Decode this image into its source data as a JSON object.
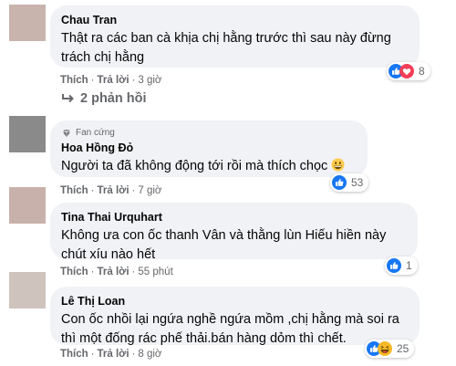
{
  "comments": [
    {
      "author": "Chau Tran",
      "text_lines": [
        "Thật ra các ban cà khịa chị hằng trước thì sau này đừng",
        "trách chị hằng"
      ],
      "like": "Thích",
      "reply": "Trả lời",
      "time": "3 giờ",
      "reaction_count": "8",
      "avatar_color": "#c9b4ad"
    },
    {
      "badge": "Fan cứng",
      "author": "Hoa Hồng Đỏ",
      "text_lines": [
        "Người ta đã không động tới rồi mà thích chọc"
      ],
      "like": "Thích",
      "reply": "Trả lời",
      "time": "7 giờ",
      "reaction_count": "53",
      "avatar_color": "#8a8a8a"
    },
    {
      "author": "Tina Thai Urquhart",
      "text_lines": [
        "Không ưa con ốc thanh Vân và thằng lùn Hiếu hiền này",
        "chút xíu nào hết"
      ],
      "like": "Thích",
      "reply": "Trả lời",
      "time": "55 phút",
      "reaction_count": "1",
      "avatar_color": "#c9b1ab"
    },
    {
      "author": "Lê Thị Loan",
      "text_lines": [
        "Con ốc nhồi lại ngứa nghề ngứa mồm ,chị hằng mà soi ra",
        "thì một đống rác phế thải.bán hàng dỏm thì chết."
      ],
      "like": "Thích",
      "reply": "Trả lời",
      "time": "8 giờ",
      "reaction_count": "25",
      "avatar_color": "#cfc3bd"
    }
  ],
  "view_replies": "2 phản hồi",
  "colors": {
    "bubble": "#f0f2f5",
    "like_blue": "#1877f2",
    "haha_yellow": "#f7b928",
    "meta_gray": "#65676b"
  }
}
